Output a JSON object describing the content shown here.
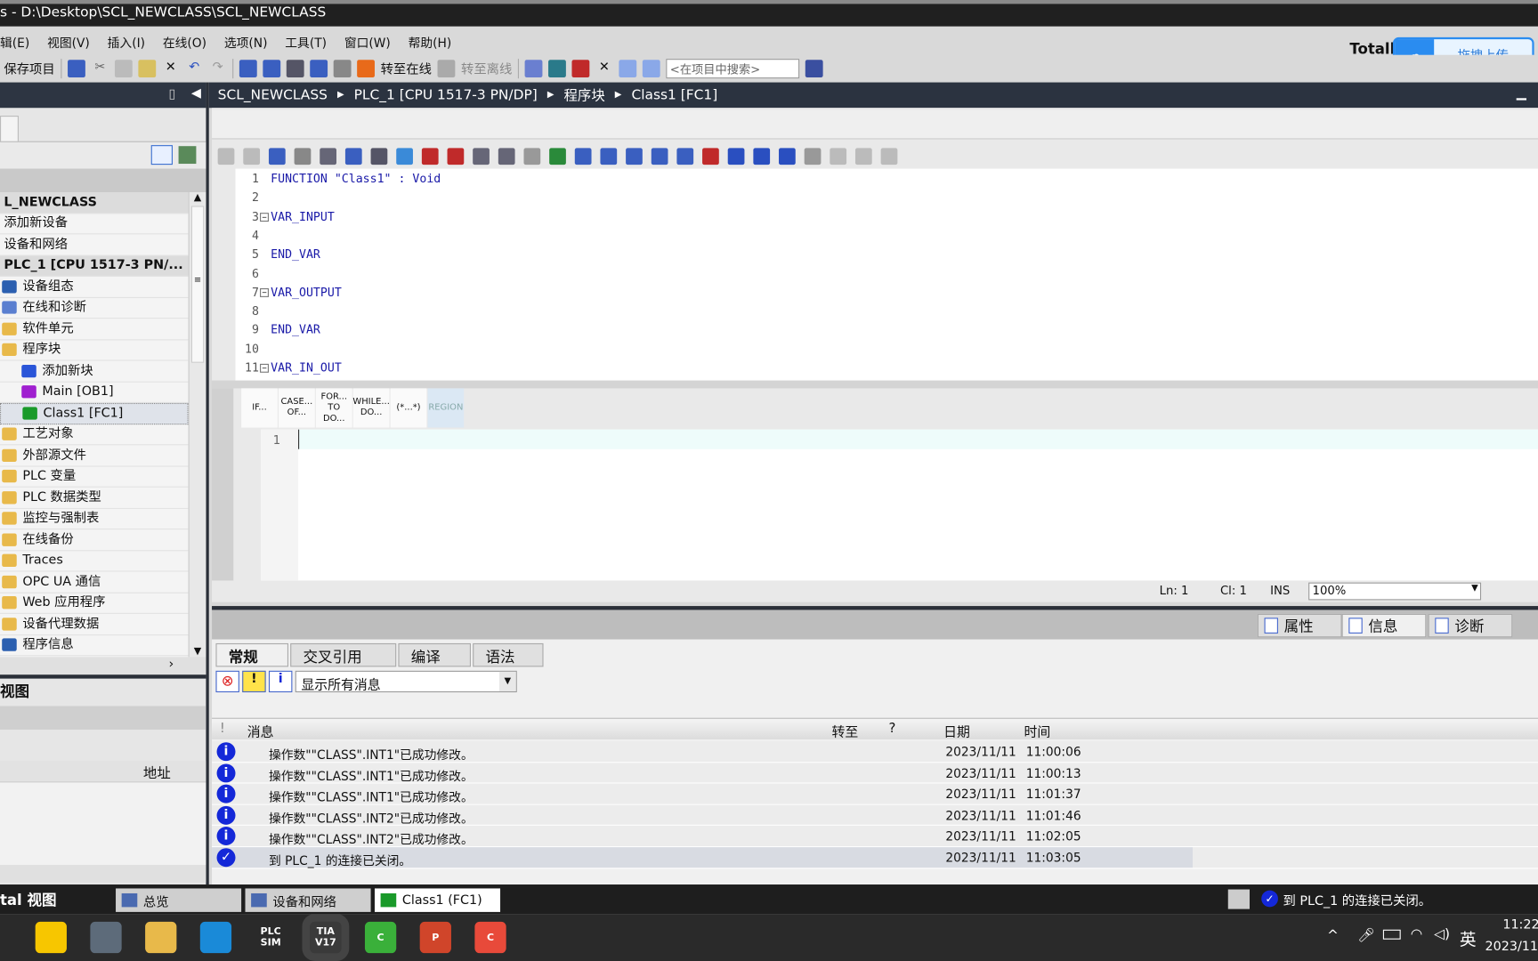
{
  "window": {
    "title": "s - D:\\Desktop\\SCL_NEWCLASS\\SCL_NEWCLASS",
    "brand_partial": "Totall"
  },
  "menu": [
    "辑(E)",
    "视图(V)",
    "插入(I)",
    "在线(O)",
    "选项(N)",
    "工具(T)",
    "窗口(W)",
    "帮助(H)"
  ],
  "toolbar": {
    "save": "保存项目",
    "go_online": "转至在线",
    "go_offline": "转至离线",
    "search_placeholder": "<在项目中搜索>"
  },
  "baidu": {
    "label": "拖拽上传"
  },
  "breadcrumb": [
    "SCL_NEWCLASS",
    "PLC_1 [CPU 1517-3 PN/DP]",
    "程序块",
    "Class1 [FC1]"
  ],
  "tree": [
    {
      "label": "L_NEWCLASS",
      "color": "#dcdcdc",
      "indent": 0
    },
    {
      "label": "添加新设备",
      "color": "",
      "indent": 0
    },
    {
      "label": "设备和网络",
      "color": "",
      "indent": 0
    },
    {
      "label": "PLC_1 [CPU 1517-3 PN/...",
      "color": "#dcdcdc",
      "indent": 0
    },
    {
      "label": "设备组态",
      "color": "#2b5fb0",
      "indent": 1
    },
    {
      "label": "在线和诊断",
      "color": "#5a7fd0",
      "indent": 1
    },
    {
      "label": "软件单元",
      "color": "#e8b94a",
      "indent": 1
    },
    {
      "label": "程序块",
      "color": "#e8b94a",
      "indent": 1
    },
    {
      "label": "添加新块",
      "color": "#2a55d8",
      "indent": 2
    },
    {
      "label": "Main [OB1]",
      "color": "#a020d0",
      "indent": 2
    },
    {
      "label": "Class1 [FC1]",
      "color": "#1a9a2a",
      "indent": 2
    },
    {
      "label": "工艺对象",
      "color": "#e8b94a",
      "indent": 1
    },
    {
      "label": "外部源文件",
      "color": "#e8b94a",
      "indent": 1
    },
    {
      "label": "PLC 变量",
      "color": "#e8b94a",
      "indent": 1
    },
    {
      "label": "PLC 数据类型",
      "color": "#e8b94a",
      "indent": 1
    },
    {
      "label": "监控与强制表",
      "color": "#e8b94a",
      "indent": 1
    },
    {
      "label": "在线备份",
      "color": "#e8b94a",
      "indent": 1
    },
    {
      "label": "Traces",
      "color": "#e8b94a",
      "indent": 1
    },
    {
      "label": "OPC UA 通信",
      "color": "#e8b94a",
      "indent": 1
    },
    {
      "label": "Web 应用程序",
      "color": "#e8b94a",
      "indent": 1
    },
    {
      "label": "设备代理数据",
      "color": "#e8b94a",
      "indent": 1
    },
    {
      "label": "程序信息",
      "color": "#2b5fb0",
      "indent": 1
    }
  ],
  "detail_view": {
    "title": "视图",
    "col_address": "地址"
  },
  "code": [
    {
      "n": "1",
      "t": "FUNCTION \"Class1\" : Void"
    },
    {
      "n": "2",
      "t": ""
    },
    {
      "n": "3",
      "t": "VAR_INPUT"
    },
    {
      "n": "4",
      "t": ""
    },
    {
      "n": "5",
      "t": "END_VAR"
    },
    {
      "n": "6",
      "t": ""
    },
    {
      "n": "7",
      "t": "VAR_OUTPUT"
    },
    {
      "n": "8",
      "t": ""
    },
    {
      "n": "9",
      "t": "END_VAR"
    },
    {
      "n": "10",
      "t": ""
    },
    {
      "n": "11",
      "t": "VAR_IN_OUT"
    }
  ],
  "snippets": [
    "IF...",
    "CASE... OF...",
    "FOR... TO DO...",
    "WHILE... DO...",
    "(*...*)",
    "REGION"
  ],
  "code2_line": "1",
  "status": {
    "ln": "Ln: 1",
    "cl": "Cl: 1",
    "mode": "INS",
    "zoom": "100%"
  },
  "inspector_tabs": [
    "属性",
    "信息",
    "诊断"
  ],
  "sub_tabs": [
    "常规",
    "交叉引用",
    "编译",
    "语法"
  ],
  "filter": "显示所有消息",
  "msg_headers": {
    "bang": "!",
    "message": "消息",
    "goto": "转至",
    "q": "?",
    "date": "日期",
    "time": "时间"
  },
  "messages": [
    {
      "icon": "info",
      "text": "操作数\"\"CLASS\".INT1\"已成功修改。",
      "date": "2023/11/11",
      "time": "11:00:06"
    },
    {
      "icon": "info",
      "text": "操作数\"\"CLASS\".INT1\"已成功修改。",
      "date": "2023/11/11",
      "time": "11:00:13"
    },
    {
      "icon": "info",
      "text": "操作数\"\"CLASS\".INT1\"已成功修改。",
      "date": "2023/11/11",
      "time": "11:01:37"
    },
    {
      "icon": "info",
      "text": "操作数\"\"CLASS\".INT2\"已成功修改。",
      "date": "2023/11/11",
      "time": "11:01:46"
    },
    {
      "icon": "info",
      "text": "操作数\"\"CLASS\".INT2\"已成功修改。",
      "date": "2023/11/11",
      "time": "11:02:05"
    },
    {
      "icon": "check",
      "text": "到 PLC_1 的连接已关闭。",
      "date": "2023/11/11",
      "time": "11:03:05"
    }
  ],
  "portal": {
    "view_label": "tal 视图",
    "tabs": [
      "总览",
      "设备和网络",
      "Class1 (FC1)"
    ],
    "status": "到 PLC_1 的连接已关闭。"
  },
  "taskbar": {
    "apps": [
      {
        "name": "sticky-notes",
        "label": "",
        "color": "#f7c600"
      },
      {
        "name": "calculator",
        "label": "",
        "color": "#5d6b7a"
      },
      {
        "name": "file-explorer",
        "label": "",
        "color": "#e8b94a"
      },
      {
        "name": "edge",
        "label": "",
        "color": "#1a8ad8"
      },
      {
        "name": "plcsim",
        "label": "PLC SIM",
        "color": "#2a2a2a"
      },
      {
        "name": "tia-portal",
        "label": "TIA V17",
        "color": "#3a3a3a"
      },
      {
        "name": "camtasia",
        "label": "C",
        "color": "#3ab03a"
      },
      {
        "name": "powerpoint",
        "label": "P",
        "color": "#d0452a"
      },
      {
        "name": "camtasia-recorder",
        "label": "C",
        "color": "#e84a3a"
      }
    ],
    "ime": "英",
    "time": "11:22",
    "date": "2023/11"
  }
}
